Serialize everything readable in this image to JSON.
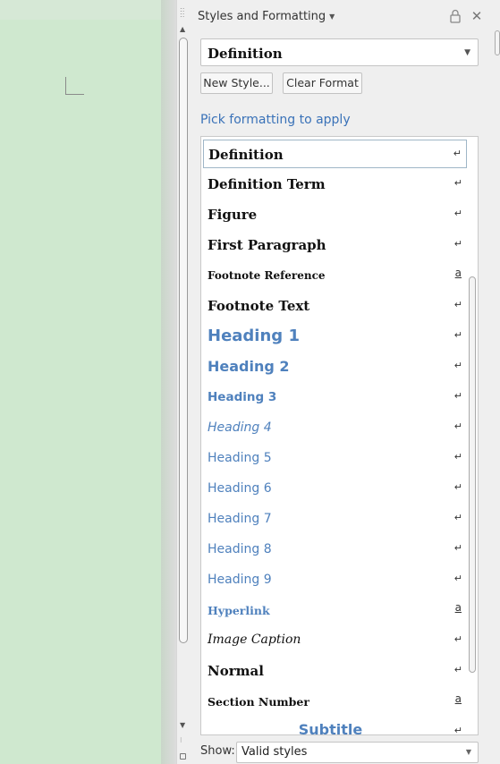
{
  "sidebar": {
    "title": "Styles and Formatting",
    "current_style": "Definition",
    "new_style_button": "New Style...",
    "clear_format_button": "Clear Format",
    "pick_label": "Pick formatting to apply",
    "show_label": "Show:",
    "show_value": "Valid styles",
    "styles": [
      {
        "name": "Definition",
        "type": "paragraph",
        "selected": true
      },
      {
        "name": "Definition Term",
        "type": "paragraph"
      },
      {
        "name": "Figure",
        "type": "paragraph"
      },
      {
        "name": "First Paragraph",
        "type": "paragraph"
      },
      {
        "name": "Footnote Reference",
        "type": "character"
      },
      {
        "name": "Footnote Text",
        "type": "paragraph"
      },
      {
        "name": "Heading 1",
        "type": "paragraph"
      },
      {
        "name": "Heading 2",
        "type": "paragraph"
      },
      {
        "name": "Heading 3",
        "type": "paragraph"
      },
      {
        "name": "Heading 4",
        "type": "paragraph"
      },
      {
        "name": "Heading 5",
        "type": "paragraph"
      },
      {
        "name": "Heading 6",
        "type": "paragraph"
      },
      {
        "name": "Heading 7",
        "type": "paragraph"
      },
      {
        "name": "Heading 8",
        "type": "paragraph"
      },
      {
        "name": "Heading 9",
        "type": "paragraph"
      },
      {
        "name": "Hyperlink",
        "type": "character"
      },
      {
        "name": "Image Caption",
        "type": "paragraph"
      },
      {
        "name": "Normal",
        "type": "paragraph"
      },
      {
        "name": "Section Number",
        "type": "character"
      },
      {
        "name": "Subtitle",
        "type": "paragraph"
      }
    ]
  },
  "icons": {
    "header_caret": "chevron-down-icon",
    "lock": "lock-icon",
    "close": "close-icon",
    "paragraph_style": "return-arrow-icon",
    "character_style": "underlined-a-icon"
  },
  "colors": {
    "document_page": "#cfe8cf",
    "heading_blue": "#4f81bd",
    "link_blue": "#3a72b8"
  }
}
